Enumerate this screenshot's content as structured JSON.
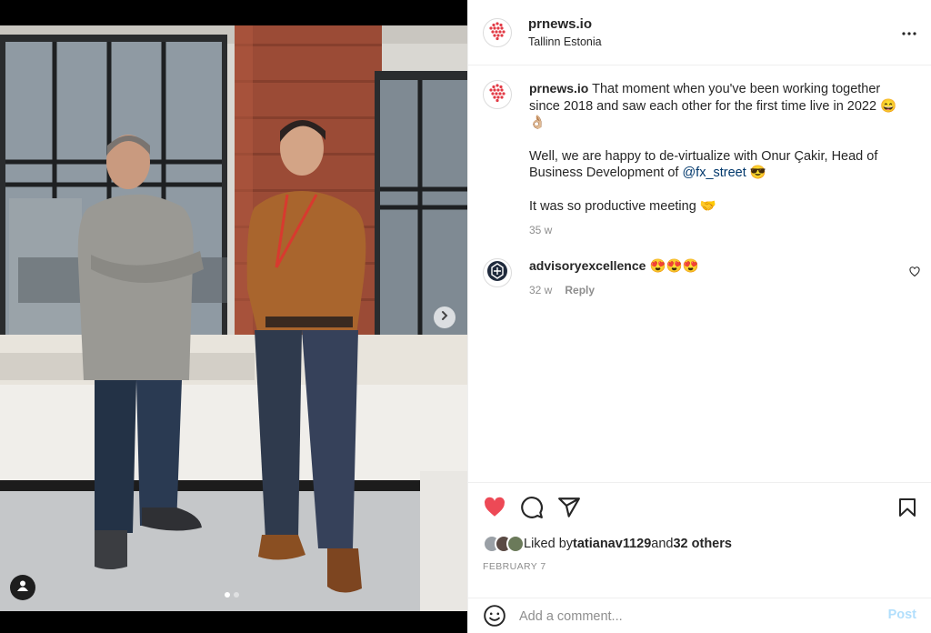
{
  "post": {
    "username": "prnews.io",
    "location": "Tallinn Estonia",
    "caption_paragraphs": [
      "That moment when you've been working together since 2018 and saw each other for the first time live in 2022 😄👌🏼",
      "Well, we are happy to de-virtualize with Onur Çakir, Head of Business Development of ",
      "It was so productive meeting 🤝"
    ],
    "caption_mention": "@fx_street",
    "caption_mention_suffix": " 😎",
    "caption_age": "35 w",
    "likes": {
      "prefix": "Liked by ",
      "first_user": "tatianav1129",
      "middle": " and ",
      "others": "32 others"
    },
    "date": "FEBRUARY 7",
    "media": {
      "slide_count": 2,
      "active_slide": 0
    }
  },
  "comments": [
    {
      "username": "advisoryexcellence",
      "text": "😍😍😍",
      "age": "32 w",
      "reply_label": "Reply"
    }
  ],
  "comment_box": {
    "placeholder": "Add a comment...",
    "post_label": "Post"
  },
  "icons": {
    "more": "more-horizontal-icon",
    "like": "heart-filled-icon",
    "comment": "comment-icon",
    "share": "share-icon",
    "save": "bookmark-icon",
    "emoji": "emoji-icon",
    "next": "chevron-right-icon",
    "tag": "user-tag-icon"
  },
  "colors": {
    "like_red": "#ed4956",
    "mention_blue": "#00376b",
    "post_disabled": "#b2dffc",
    "brand_red": "#e23a45"
  }
}
